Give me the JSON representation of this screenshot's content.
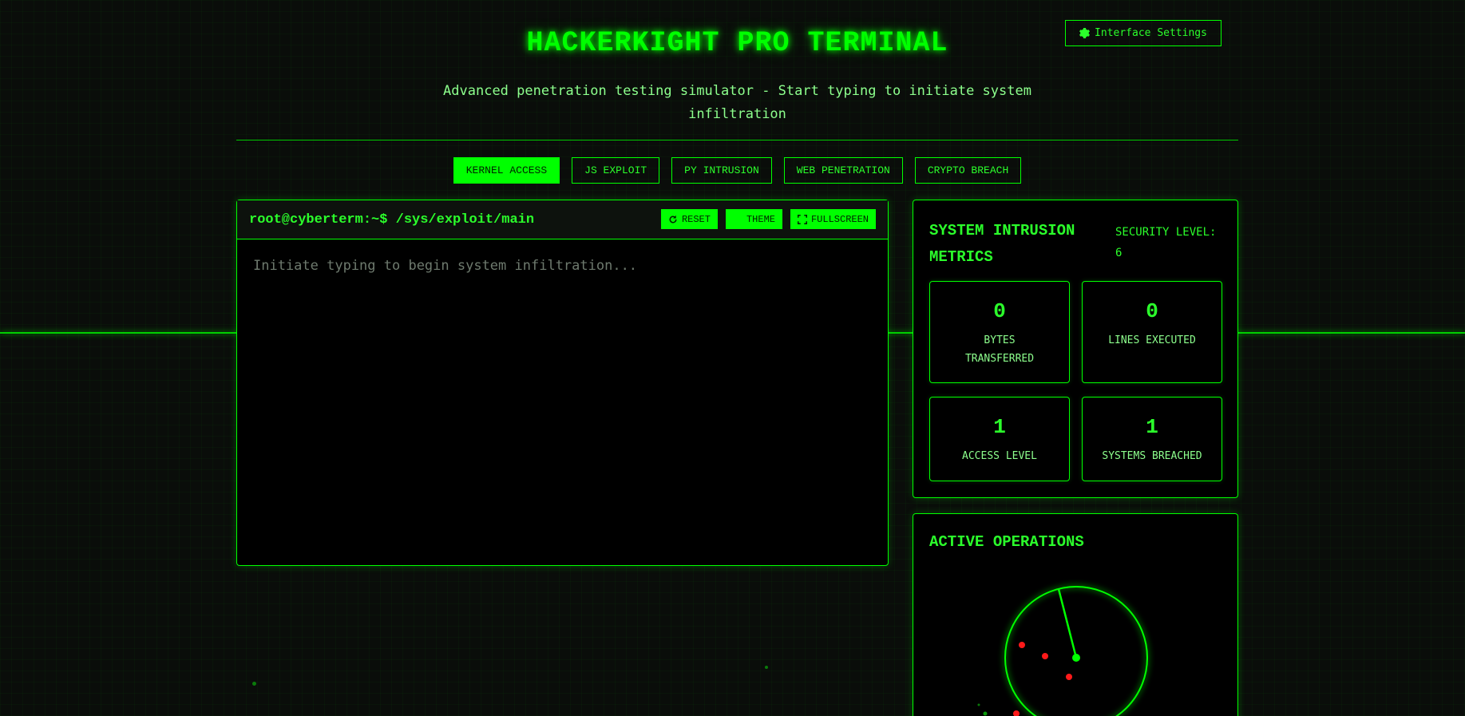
{
  "header": {
    "title": "HACKERKIGHT PRO TERMINAL",
    "subtitle": "Advanced penetration testing simulator - Start typing to initiate system infiltration",
    "settings_label": "Interface Settings"
  },
  "tabs": [
    {
      "label": "KERNEL ACCESS",
      "active": true
    },
    {
      "label": "JS EXPLOIT",
      "active": false
    },
    {
      "label": "PY INTRUSION",
      "active": false
    },
    {
      "label": "WEB PENETRATION",
      "active": false
    },
    {
      "label": "CRYPTO BREACH",
      "active": false
    }
  ],
  "terminal": {
    "prompt": "root@cyberterm:~$ /sys/exploit/main",
    "placeholder": "Initiate typing to begin system infiltration...",
    "reset_label": "RESET",
    "theme_label": "THEME",
    "fullscreen_label": "FULLSCREEN"
  },
  "metrics": {
    "title": "SYSTEM INTRUSION METRICS",
    "security_level": "SECURITY LEVEL: 6",
    "cards": [
      {
        "value": "0",
        "label": "BYTES TRANSFERRED"
      },
      {
        "value": "0",
        "label": "LINES EXECUTED"
      },
      {
        "value": "1",
        "label": "ACCESS LEVEL"
      },
      {
        "value": "1",
        "label": "SYSTEMS BREACHED"
      }
    ]
  },
  "operations": {
    "title": "ACTIVE OPERATIONS"
  },
  "colors": {
    "accent": "#00ff00",
    "background": "#0a0d0a",
    "threat": "#ff1a1a"
  }
}
